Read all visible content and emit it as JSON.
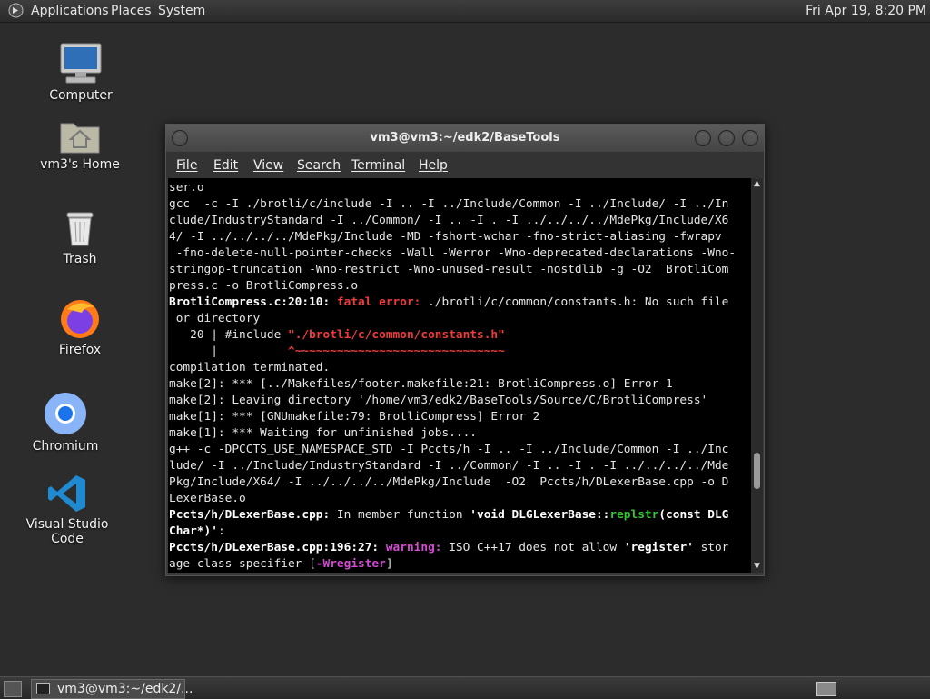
{
  "top_panel": {
    "menus": [
      "Applications",
      "Places",
      "System"
    ],
    "clock": "Fri Apr 19,  8:20 PM",
    "logo_icon": "gnome-foot-icon"
  },
  "desktop_icons": [
    {
      "label": "Computer",
      "icon": "computer-icon"
    },
    {
      "label": "vm3's Home",
      "icon": "home-folder-icon"
    },
    {
      "label": "Trash",
      "icon": "trash-icon"
    },
    {
      "label": "Firefox",
      "icon": "firefox-icon"
    },
    {
      "label": "Chromium",
      "icon": "chromium-icon"
    },
    {
      "label": "Visual Studio Code",
      "icon": "vscode-icon"
    }
  ],
  "terminal": {
    "title": "vm3@vm3:~/edk2/BaseTools",
    "menus": [
      "File",
      "Edit",
      "View",
      "Search",
      "Terminal",
      "Help"
    ],
    "lines": [
      [
        {
          "t": "ser.o"
        }
      ],
      [
        {
          "t": "gcc  -c -I ./brotli/c/include -I .. -I ../Include/Common -I ../Include/ -I ../In"
        }
      ],
      [
        {
          "t": "clude/IndustryStandard -I ../Common/ -I .. -I . -I ../../../../MdePkg/Include/X6"
        }
      ],
      [
        {
          "t": "4/ -I ../../../../MdePkg/Include -MD -fshort-wchar -fno-strict-aliasing -fwrapv"
        }
      ],
      [
        {
          "t": " -fno-delete-null-pointer-checks -Wall -Werror -Wno-deprecated-declarations -Wno-"
        }
      ],
      [
        {
          "t": "stringop-truncation -Wno-restrict -Wno-unused-result -nostdlib -g -O2  BrotliCom"
        }
      ],
      [
        {
          "t": "press.c -o BrotliCompress.o"
        }
      ],
      [
        {
          "t": "BrotliCompress.c:20:10: ",
          "c": "b"
        },
        {
          "t": "fatal error: ",
          "c": "red"
        },
        {
          "t": "./brotli/c/common/constants.h: No such file"
        }
      ],
      [
        {
          "t": " or directory"
        }
      ],
      [
        {
          "t": "   20 | #include "
        },
        {
          "t": "\"./brotli/c/common/constants.h\"",
          "c": "red"
        }
      ],
      [
        {
          "t": "      |          "
        },
        {
          "t": "^~~~~~~~~~~~~~~~~~~~~~~~~~~~~~~",
          "c": "red"
        }
      ],
      [
        {
          "t": "compilation terminated."
        }
      ],
      [
        {
          "t": "make[2]: *** [../Makefiles/footer.makefile:21: BrotliCompress.o] Error 1"
        }
      ],
      [
        {
          "t": "make[2]: Leaving directory '/home/vm3/edk2/BaseTools/Source/C/BrotliCompress'"
        }
      ],
      [
        {
          "t": "make[1]: *** [GNUmakefile:79: BrotliCompress] Error 2"
        }
      ],
      [
        {
          "t": "make[1]: *** Waiting for unfinished jobs...."
        }
      ],
      [
        {
          "t": "g++ -c -DPCCTS_USE_NAMESPACE_STD -I Pccts/h -I .. -I ../Include/Common -I ../Inc"
        }
      ],
      [
        {
          "t": "lude/ -I ../Include/IndustryStandard -I ../Common/ -I .. -I . -I ../../../../Mde"
        }
      ],
      [
        {
          "t": "Pkg/Include/X64/ -I ../../../../MdePkg/Include  -O2  Pccts/h/DLexerBase.cpp -o D"
        }
      ],
      [
        {
          "t": "LexerBase.o"
        }
      ],
      [
        {
          "t": "Pccts/h/DLexerBase.cpp: ",
          "c": "b"
        },
        {
          "t": "In member function "
        },
        {
          "t": "'void DLGLexerBase::",
          "c": "b"
        },
        {
          "t": "replstr",
          "c": "grn"
        },
        {
          "t": "(const DLG",
          "c": "b"
        }
      ],
      [
        {
          "t": "Char*)'",
          "c": "b"
        },
        {
          "t": ":"
        }
      ],
      [
        {
          "t": "Pccts/h/DLexerBase.cpp:196:27: ",
          "c": "b"
        },
        {
          "t": "warning: ",
          "c": "mag"
        },
        {
          "t": "ISO C++17 does not allow "
        },
        {
          "t": "'register'",
          "c": "b"
        },
        {
          "t": " stor"
        }
      ],
      [
        {
          "t": "age class specifier ["
        },
        {
          "t": "-Wregister",
          "c": "mag"
        },
        {
          "t": "]"
        }
      ]
    ]
  },
  "taskbar": {
    "task_label": "vm3@vm3:~/edk2/..."
  }
}
